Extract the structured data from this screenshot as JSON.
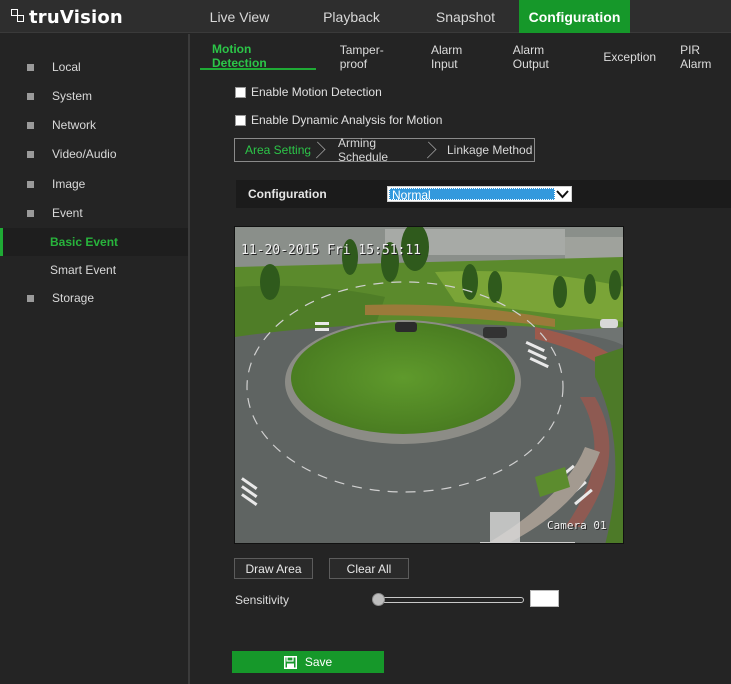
{
  "brand": {
    "logo_text": "truVision"
  },
  "top_nav": {
    "items": [
      {
        "label": "Live View",
        "active": false
      },
      {
        "label": "Playback",
        "active": false
      },
      {
        "label": "Snapshot",
        "active": false
      },
      {
        "label": "Configuration",
        "active": true
      }
    ]
  },
  "sidebar": {
    "items": [
      {
        "label": "Local",
        "type": "section"
      },
      {
        "label": "System",
        "type": "section"
      },
      {
        "label": "Network",
        "type": "section"
      },
      {
        "label": "Video/Audio",
        "type": "section"
      },
      {
        "label": "Image",
        "type": "section"
      },
      {
        "label": "Event",
        "type": "section"
      },
      {
        "label": "Basic Event",
        "type": "sub",
        "selected": true
      },
      {
        "label": "Smart Event",
        "type": "sub"
      },
      {
        "label": "Storage",
        "type": "section"
      }
    ]
  },
  "sub_tabs": {
    "items": [
      {
        "label": "Motion Detection",
        "active": true
      },
      {
        "label": "Tamper-proof"
      },
      {
        "label": "Alarm Input"
      },
      {
        "label": "Alarm Output"
      },
      {
        "label": "Exception"
      },
      {
        "label": "PIR Alarm"
      }
    ]
  },
  "options": {
    "enable_motion": {
      "label": "Enable Motion Detection",
      "checked": false
    },
    "enable_dynamic": {
      "label": "Enable Dynamic Analysis for Motion",
      "checked": false
    }
  },
  "steps": {
    "items": [
      {
        "label": "Area Settings",
        "active": true
      },
      {
        "label": "Arming Schedule"
      },
      {
        "label": "Linkage Method"
      }
    ]
  },
  "configuration": {
    "label": "Configuration",
    "selected": "Normal"
  },
  "video": {
    "timestamp": "11-20-2015  Fri 15:51:11",
    "camera_name": "Camera 01"
  },
  "buttons": {
    "draw_area": "Draw Area",
    "clear_all": "Clear All",
    "save": "Save"
  },
  "sensitivity": {
    "label": "Sensitivity",
    "value_fraction": 0.0,
    "value_text": ""
  },
  "colors": {
    "accent": "#16982a",
    "accent_text": "#2cc548",
    "background": "#242424",
    "select_highlight": "#3399dd"
  },
  "icons": {
    "save": "floppy-disk-icon",
    "dropdown": "chevron-down-icon",
    "logo": "truvision-logo-icon"
  }
}
